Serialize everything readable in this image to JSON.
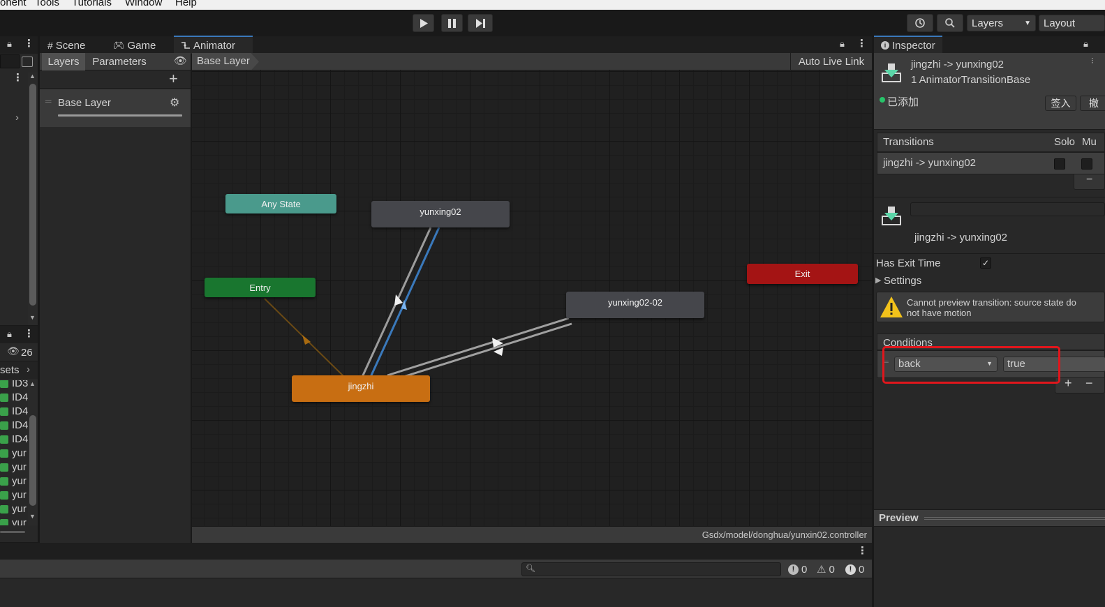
{
  "menubar": [
    "onent",
    "Tools",
    "Tutorials",
    "Window",
    "Help"
  ],
  "toolbar": {
    "layers_dropdown": "Layers",
    "layout_dropdown": "Layout"
  },
  "tabs": {
    "scene": "Scene",
    "game": "Game",
    "animator": "Animator",
    "inspector": "Inspector"
  },
  "animator": {
    "subtabs": {
      "layers": "Layers",
      "parameters": "Parameters"
    },
    "breadcrumb": "Base Layer",
    "auto_live_link": "Auto Live Link",
    "layer_item": "Base Layer",
    "footer_path": "Gsdx/model/donghua/yunxin02.controller",
    "nodes": {
      "any_state": "Any State",
      "entry": "Entry",
      "exit": "Exit",
      "yunxing02": "yunxing02",
      "yunxing02_02": "yunxing02-02",
      "jingzhi": "jingzhi"
    },
    "colors": {
      "any_state": "#4a9a8c",
      "entry": "#19762f",
      "exit": "#a41414",
      "state": "#45464b",
      "default_state": "#c86e12",
      "selected_transition": "#3a79bb"
    }
  },
  "project": {
    "hidden_count": "26",
    "breadcrumb": "sets",
    "files": [
      "ID3",
      "ID4",
      "ID4",
      "ID4",
      "ID4",
      "yur",
      "yur",
      "yur",
      "yur",
      "yur",
      "yur"
    ]
  },
  "console": {
    "count_info": "0",
    "count_warn": "0",
    "count_error": "0"
  },
  "inspector": {
    "title": "jingzhi -> yunxing02",
    "subtitle": "1 AnimatorTransitionBase",
    "vc_status": "已添加",
    "checkin": "签入",
    "revert": "撤",
    "transitions_header": "Transitions",
    "solo": "Solo",
    "mute": "Mu",
    "transition_row": "jingzhi -> yunxing02",
    "transition_name": "jingzhi -> yunxing02",
    "has_exit_time": "Has Exit Time",
    "settings": "Settings",
    "warning_text_1": "Cannot preview transition: source state do",
    "warning_text_2": "not have motion",
    "conditions_header": "Conditions",
    "condition_param": "back",
    "condition_value": "true",
    "preview": "Preview",
    "highlight_color": "#e0161c"
  }
}
